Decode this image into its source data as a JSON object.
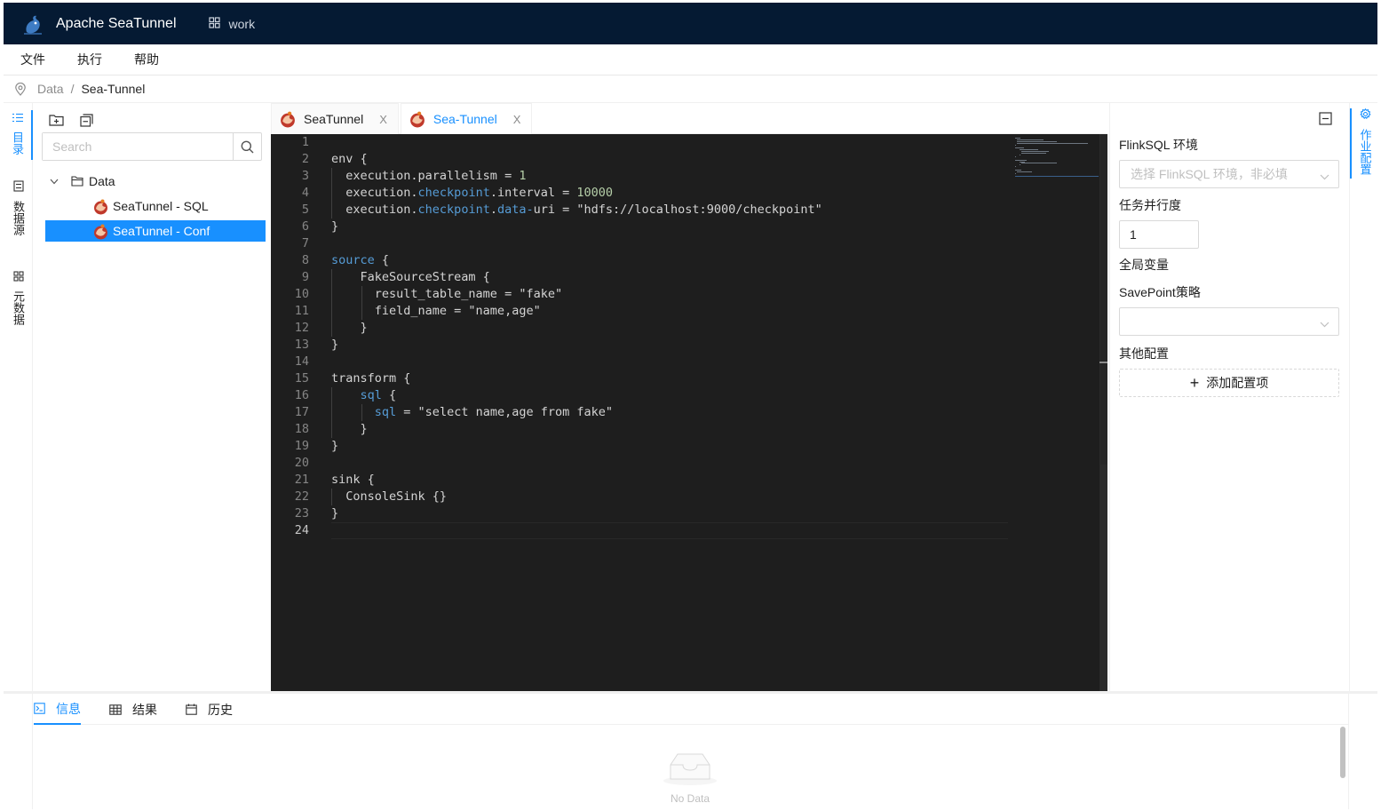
{
  "header": {
    "app_title": "Apache SeaTunnel",
    "project": "work"
  },
  "menu": [
    "文件",
    "执行",
    "帮助"
  ],
  "breadcrumb": [
    "Data",
    "Sea-Tunnel"
  ],
  "breadcrumb_sep": "/",
  "left_tabs": [
    {
      "label": "目录",
      "icon": "list-icon"
    },
    {
      "label": "数据源",
      "icon": "database-icon"
    },
    {
      "label": "元数据",
      "icon": "grid-icon"
    }
  ],
  "tree": {
    "search_placeholder": "Search",
    "root": "Data",
    "items": [
      "SeaTunnel - SQL",
      "SeaTunnel - Conf"
    ],
    "selected": "SeaTunnel - Conf"
  },
  "editor": {
    "tabs": [
      {
        "label": "SeaTunnel",
        "close": "X"
      },
      {
        "label": "Sea-Tunnel",
        "close": "X"
      }
    ],
    "active_tab": "Sea-Tunnel",
    "lines": [
      "",
      "env {",
      "  execution.parallelism = 1",
      "  execution.checkpoint.interval = 10000",
      "  execution.checkpoint.data-uri = \"hdfs://localhost:9000/checkpoint\"",
      "}",
      "",
      "source {",
      "    FakeSourceStream {",
      "      result_table_name = \"fake\"",
      "      field_name = \"name,age\"",
      "    }",
      "}",
      "",
      "transform {",
      "    sql {",
      "      sql = \"select name,age from fake\"",
      "    }",
      "}",
      "",
      "sink {",
      "  ConsoleSink {}",
      "}",
      ""
    ],
    "cursor_line": 24
  },
  "job_config": {
    "tab_label": "作业配置",
    "flinksql_env_label": "FlinkSQL 环境",
    "flinksql_env_placeholder": "选择 FlinkSQL 环境，非必填",
    "parallelism_label": "任务并行度",
    "parallelism_value": "1",
    "global_vars_label": "全局变量",
    "savepoint_label": "SavePoint策略",
    "savepoint_value": "",
    "other_config_label": "其他配置",
    "add_config_label": "添加配置项"
  },
  "bottom": {
    "tabs": [
      "信息",
      "结果",
      "历史"
    ],
    "active": "信息",
    "empty_text": "No Data"
  },
  "colors": {
    "header_bg": "#051a33",
    "accent": "#1890ff",
    "editor_bg": "#1e1e1e",
    "keyword": "#569cd6",
    "number": "#b5cea8"
  }
}
